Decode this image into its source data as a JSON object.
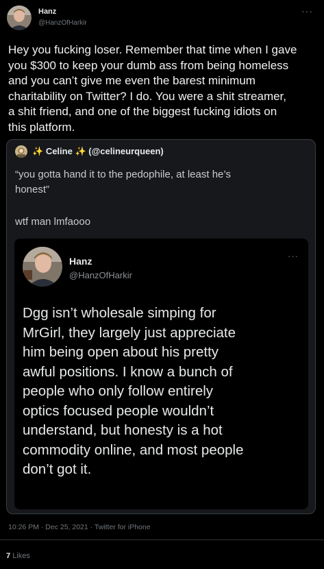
{
  "tweet": {
    "author_name": "Hanz",
    "author_handle": "@HanzOfHarkir",
    "more_icon": "more-dots-icon",
    "text": "Hey you fucking loser. Remember that time when I gave\nyou $300 to keep your dumb ass from being homeless\nand you can’t give me even the barest minimum\ncharitability on Twitter? I do. You were a shit streamer,\na shit friend, and one of the biggest fucking idiots on\nthis platform."
  },
  "quote": {
    "author_name": "Celine",
    "sparkle_left": "✨",
    "sparkle_right": "✨",
    "author_handle": "(@celineurqueen)",
    "text": "“you gotta hand it to the pedophile, at least he’s\nhonest”",
    "text2": "wtf man lmfaooo",
    "inner": {
      "author_name": "Hanz",
      "author_handle": "@HanzOfHarkir",
      "text": "Dgg isn’t wholesale simping for\nMrGirl, they largely just appreciate\nhim being open about his pretty\nawful positions. I know a bunch of\npeople who only follow entirely\noptics focused people wouldn’t\nunderstand, but honesty is a hot\ncommodity online, and most people\ndon’t got it."
    }
  },
  "meta": {
    "timestamp": "10:26 PM · Dec 25, 2021 · Twitter for iPhone"
  },
  "stats": {
    "likes_count": "7",
    "likes_label": "Likes"
  },
  "colors": {
    "background": "#000000",
    "quote_background": "#16181c",
    "secondary_text": "#71767b",
    "primary_text": "#e7e9ea"
  }
}
